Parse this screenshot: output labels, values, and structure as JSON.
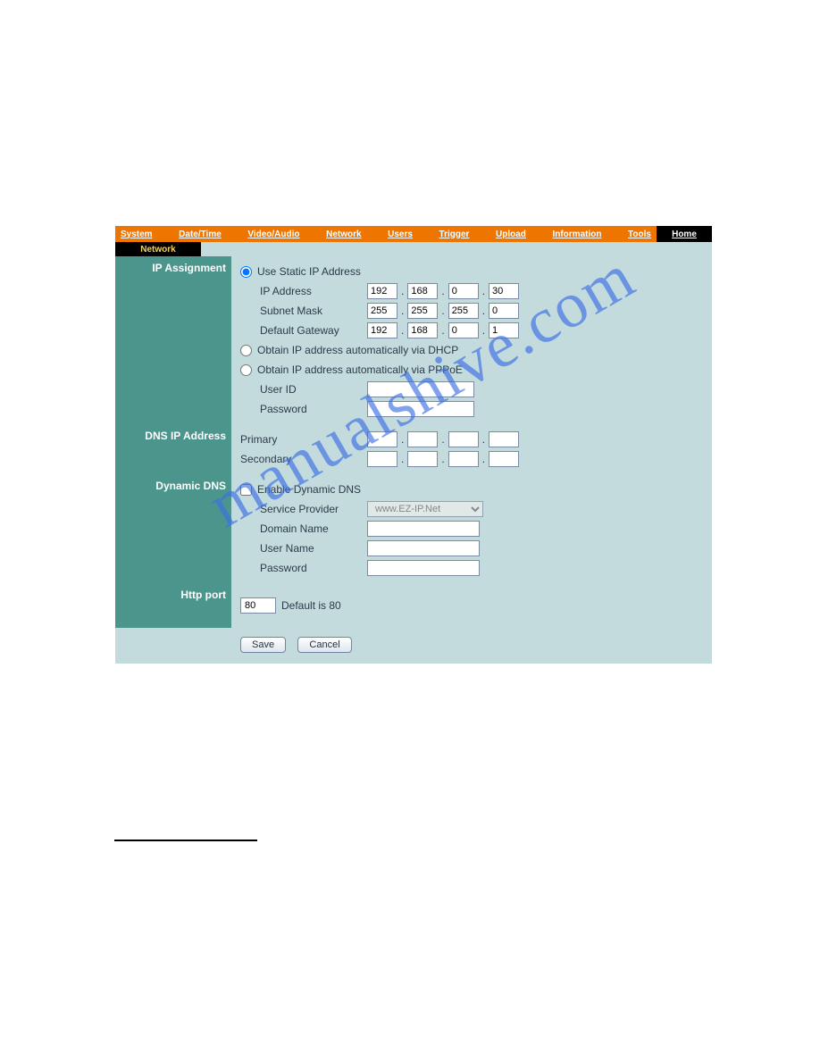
{
  "watermark": "manualshive.com",
  "topnav": {
    "items": [
      "System",
      "Date/Time",
      "Video/Audio",
      "Network",
      "Users",
      "Trigger",
      "Upload",
      "Information",
      "Tools"
    ],
    "home": "Home"
  },
  "subnav": {
    "current": "Network"
  },
  "sections": {
    "ip_assignment": {
      "title": "IP Assignment",
      "static_label": "Use Static IP Address",
      "ip_label": "IP Address",
      "ip": [
        "192",
        "168",
        "0",
        "30"
      ],
      "mask_label": "Subnet Mask",
      "mask": [
        "255",
        "255",
        "255",
        "0"
      ],
      "gw_label": "Default Gateway",
      "gw": [
        "192",
        "168",
        "0",
        "1"
      ],
      "dhcp_label": "Obtain IP address automatically via DHCP",
      "pppoe_label": "Obtain IP address automatically via PPPoE",
      "pppoe_user_label": "User ID",
      "pppoe_pass_label": "Password",
      "pppoe_user": "",
      "pppoe_pass": ""
    },
    "dns": {
      "title": "DNS IP Address",
      "primary_label": "Primary",
      "secondary_label": "Secondary",
      "primary": [
        "",
        "",
        "",
        ""
      ],
      "secondary": [
        "",
        "",
        "",
        ""
      ]
    },
    "ddns": {
      "title": "Dynamic DNS",
      "enable_label": "Enable Dynamic DNS",
      "provider_label": "Service Provider",
      "provider_value": "www.EZ-IP.Net",
      "domain_label": "Domain Name",
      "user_label": "User Name",
      "pass_label": "Password",
      "domain": "",
      "user": "",
      "pass": ""
    },
    "http": {
      "title": "Http port",
      "value": "80",
      "hint": "Default is 80"
    }
  },
  "buttons": {
    "save": "Save",
    "cancel": "Cancel"
  }
}
